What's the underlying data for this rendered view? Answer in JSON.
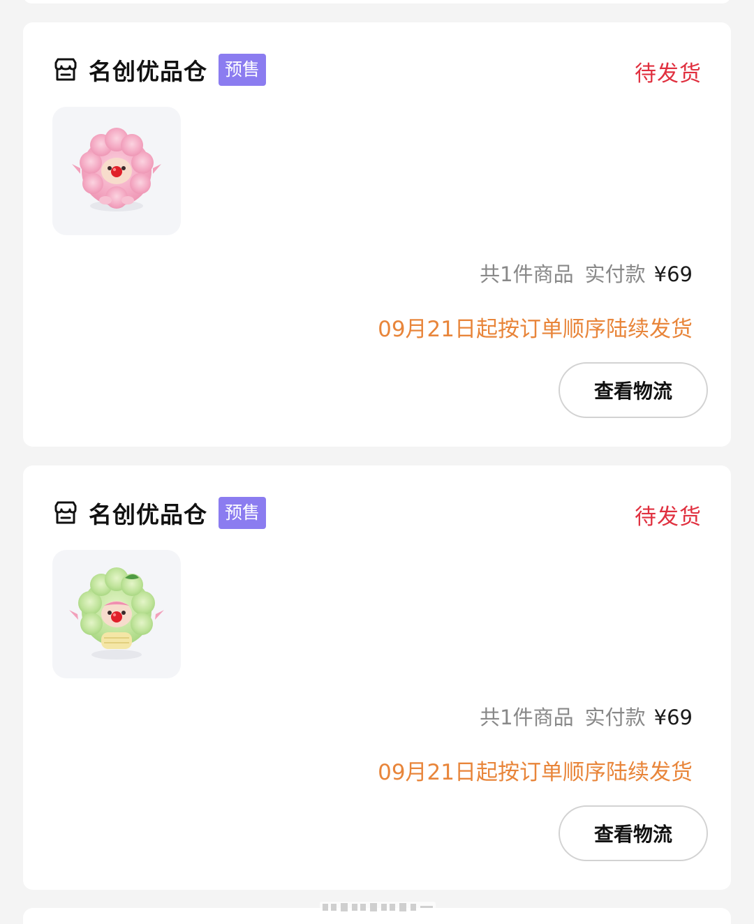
{
  "orders": [
    {
      "shop_icon": "store-icon",
      "shop_name": "名创优品仓",
      "tag": "预售",
      "status": "待发货",
      "product_image": "pink-fluffy-figure",
      "item_count_text": "共1件商品",
      "paid_label": "实付款",
      "paid_amount": "¥69",
      "shipping_note": "09月21日起按订单顺序陆续发货",
      "button_label": "查看物流"
    },
    {
      "shop_icon": "store-icon",
      "shop_name": "名创优品仓",
      "tag": "预售",
      "status": "待发货",
      "product_image": "green-fluffy-figure",
      "item_count_text": "共1件商品",
      "paid_label": "实付款",
      "paid_amount": "¥69",
      "shipping_note": "09月21日起按订单顺序陆续发货",
      "button_label": "查看物流"
    }
  ],
  "colors": {
    "status_red": "#e0303f",
    "tag_purple": "#8b7cf0",
    "shipping_orange": "#e8853a",
    "page_bg": "#f4f4f4"
  }
}
